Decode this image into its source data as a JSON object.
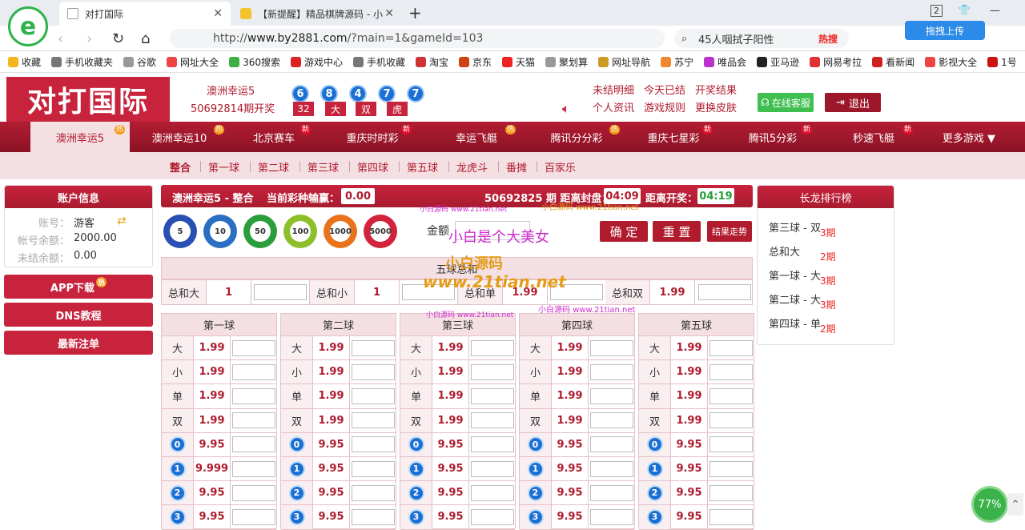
{
  "browser": {
    "tabs": [
      {
        "label": "对打国际"
      },
      {
        "label": "【新提醒】精品棋牌源码 - 小"
      }
    ],
    "url_prefix": "http://",
    "url_host": "www.by2881.com",
    "url_path": "/?main=1&gameId=103",
    "search_text": "45人咽拭子阳性",
    "search_hot": "热搜",
    "upload_label": "拖拽上传",
    "tab_count": "2",
    "bookmarks": [
      "收藏",
      "手机收藏夹",
      "谷歌",
      "网址大全",
      "360搜索",
      "游戏中心",
      "手机收藏",
      "淘宝",
      "京东",
      "天猫",
      "聚划算",
      "网址导航",
      "苏宁",
      "唯品会",
      "亚马逊",
      "网易考拉",
      "看新闻",
      "影视大全",
      "1号"
    ],
    "zoom_pct": "77%"
  },
  "header": {
    "logo_text": "对打国际",
    "lottery_name": "澳洲幸运5",
    "period": "50692814期开奖",
    "balls": [
      "6",
      "8",
      "4",
      "7",
      "7"
    ],
    "results": [
      "32",
      "大",
      "双",
      "虎"
    ],
    "links": [
      "未结明细",
      "今天已结",
      "开奖结果",
      "个人资讯",
      "游戏规则",
      "更换皮肤"
    ],
    "service_btn": "在线客服",
    "logout_btn": "退出"
  },
  "game_nav": [
    {
      "label": "澳洲幸运5",
      "badge": "热"
    },
    {
      "label": "澳洲幸运10",
      "badge": "热"
    },
    {
      "label": "北京赛车",
      "badge": "新"
    },
    {
      "label": "重庆时时彩",
      "badge": "新"
    },
    {
      "label": "幸运飞艇",
      "badge": "热"
    },
    {
      "label": "腾讯分分彩",
      "badge": "热"
    },
    {
      "label": "重庆七星彩",
      "badge": "新"
    },
    {
      "label": "腾讯5分彩",
      "badge": "新"
    },
    {
      "label": "秒速飞艇",
      "badge": "新"
    },
    {
      "label": "更多游戏 ▼",
      "badge": ""
    }
  ],
  "sub_nav": [
    "整合",
    "第一球",
    "第二球",
    "第三球",
    "第四球",
    "第五球",
    "龙虎斗",
    "番摊",
    "百家乐"
  ],
  "account": {
    "title": "账户信息",
    "rows": [
      {
        "label": "账号：",
        "value": "游客"
      },
      {
        "label": "帐号余额：",
        "value": "2000.00"
      },
      {
        "label": "未结余额：",
        "value": "0.00"
      }
    ]
  },
  "sidebar_buttons": [
    {
      "label": "APP下载",
      "badge": "热"
    },
    {
      "label": "DNS教程",
      "badge": ""
    },
    {
      "label": "最新注单",
      "badge": ""
    }
  ],
  "main": {
    "title": "澳洲幸运5 - 整合",
    "profit_label": "当前彩种输赢：",
    "profit": "0.00",
    "period_label": "50692825 期 距离封盘：",
    "close_time": "04:09",
    "open_label": "距离开奖：",
    "open_time": "04:19",
    "chips": [
      "5",
      "10",
      "50",
      "100",
      "1000",
      "5000"
    ],
    "amount_label": "金额",
    "confirm": "确 定",
    "reset": "重 置",
    "trend": "结果走势",
    "watermark_1": "小白是个大美女",
    "watermark_2": "小白源码",
    "watermark_3": "www.21tian.net",
    "watermark_4": "小白源码 www.21tian.net",
    "sum_title": "五球总和",
    "sum_items": [
      {
        "label": "总和大",
        "odds": "1"
      },
      {
        "label": "总和小",
        "odds": "1"
      },
      {
        "label": "总和单",
        "odds": "1.99"
      },
      {
        "label": "总和双",
        "odds": "1.99"
      }
    ]
  },
  "ball_columns": [
    {
      "title": "第一球",
      "rows": [
        {
          "k": "大",
          "v": "1.99"
        },
        {
          "k": "小",
          "v": "1.99"
        },
        {
          "k": "单",
          "v": "1.99"
        },
        {
          "k": "双",
          "v": "1.99"
        },
        {
          "k": "0",
          "v": "9.95"
        },
        {
          "k": "1",
          "v": "9.999"
        },
        {
          "k": "2",
          "v": "9.95"
        },
        {
          "k": "3",
          "v": "9.95"
        }
      ]
    },
    {
      "title": "第二球",
      "rows": [
        {
          "k": "大",
          "v": "1.99"
        },
        {
          "k": "小",
          "v": "1.99"
        },
        {
          "k": "单",
          "v": "1.99"
        },
        {
          "k": "双",
          "v": "1.99"
        },
        {
          "k": "0",
          "v": "9.95"
        },
        {
          "k": "1",
          "v": "9.95"
        },
        {
          "k": "2",
          "v": "9.95"
        },
        {
          "k": "3",
          "v": "9.95"
        }
      ]
    },
    {
      "title": "第三球",
      "rows": [
        {
          "k": "大",
          "v": "1.99"
        },
        {
          "k": "小",
          "v": "1.99"
        },
        {
          "k": "单",
          "v": "1.99"
        },
        {
          "k": "双",
          "v": "1.99"
        },
        {
          "k": "0",
          "v": "9.95"
        },
        {
          "k": "1",
          "v": "9.95"
        },
        {
          "k": "2",
          "v": "9.95"
        },
        {
          "k": "3",
          "v": "9.95"
        }
      ]
    },
    {
      "title": "第四球",
      "rows": [
        {
          "k": "大",
          "v": "1.99"
        },
        {
          "k": "小",
          "v": "1.99"
        },
        {
          "k": "单",
          "v": "1.99"
        },
        {
          "k": "双",
          "v": "1.99"
        },
        {
          "k": "0",
          "v": "9.95"
        },
        {
          "k": "1",
          "v": "9.95"
        },
        {
          "k": "2",
          "v": "9.95"
        },
        {
          "k": "3",
          "v": "9.95"
        }
      ]
    },
    {
      "title": "第五球",
      "rows": [
        {
          "k": "大",
          "v": "1.99"
        },
        {
          "k": "小",
          "v": "1.99"
        },
        {
          "k": "单",
          "v": "1.99"
        },
        {
          "k": "双",
          "v": "1.99"
        },
        {
          "k": "0",
          "v": "9.95"
        },
        {
          "k": "1",
          "v": "9.95"
        },
        {
          "k": "2",
          "v": "9.95"
        },
        {
          "k": "3",
          "v": "9.95"
        }
      ]
    }
  ],
  "rank": {
    "title": "长龙排行榜",
    "items": [
      {
        "label": "第三球 - 双",
        "periods": "3期"
      },
      {
        "label": "总和大",
        "periods": "2期"
      },
      {
        "label": "第一球 - 大",
        "periods": "3期"
      },
      {
        "label": "第二球 - 大",
        "periods": "3期"
      },
      {
        "label": "第四球 - 单",
        "periods": "2期"
      }
    ]
  },
  "colors": {
    "brand": "#c8233c",
    "ball": "#1c6fd3",
    "nav_active": "#f4dfe3"
  }
}
